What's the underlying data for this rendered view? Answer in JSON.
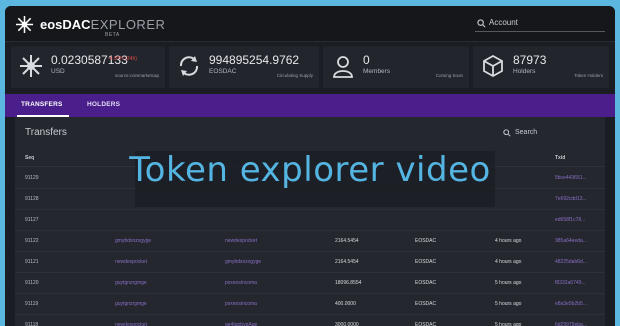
{
  "app": {
    "brand_bold": "eosDAC",
    "brand_thin": "EXPLORER",
    "beta": "BETA",
    "account_placeholder": "Account"
  },
  "stats": [
    {
      "value": "0.0230587133",
      "sub": "USD",
      "change": "-4.97% (24h)",
      "note": "source:coinmarketcap",
      "icon": "eosdac-logo-icon"
    },
    {
      "value": "994895254.9762",
      "sub": "EOSDAC",
      "note": "Circulating Supply",
      "icon": "refresh-circle-icon"
    },
    {
      "value": "0",
      "sub": "Members",
      "note": "Coming Soon",
      "icon": "user-icon"
    },
    {
      "value": "87973",
      "sub": "Holders",
      "note": "Token Holders",
      "icon": "cube-icon"
    }
  ],
  "tabs": [
    {
      "label": "TRANSFERS",
      "active": true
    },
    {
      "label": "HOLDERS",
      "active": false
    }
  ],
  "panel": {
    "title": "Transfers",
    "search_placeholder": "Search"
  },
  "table": {
    "columns": {
      "seq": "Seq",
      "txid": "Txid"
    },
    "rows": [
      {
        "seq": "91129",
        "from": "",
        "to": "",
        "qty": "",
        "symbol": "",
        "time": "",
        "txid": "5bce443651..."
      },
      {
        "seq": "91128",
        "from": "",
        "to": "",
        "qty": "",
        "symbol": "",
        "time": "",
        "txid": "7e692cdd13..."
      },
      {
        "seq": "91127",
        "from": "",
        "to": "",
        "qty": "",
        "symbol": "",
        "time": "",
        "txid": "ed658f1c78..."
      },
      {
        "seq": "91122",
        "from": "gmybdsnzxgyge",
        "to": "newdexpocket",
        "qty": "2164.5454",
        "symbol": "EOSDAC",
        "time": "4 hours ago",
        "txid": "985a64eeda..."
      },
      {
        "seq": "91121",
        "from": "newdexpocket",
        "to": "gmybdsnzxgyge",
        "qty": "2164.5454",
        "symbol": "EOSDAC",
        "time": "4 hours ago",
        "txid": "48225dab6d..."
      },
      {
        "seq": "91120",
        "from": "guytgnzrgmge",
        "to": "pxxeosincoma",
        "qty": "18096.8554",
        "symbol": "EOSDAC",
        "time": "5 hours ago",
        "txid": "f8332a6749..."
      },
      {
        "seq": "91119",
        "from": "guytgnzrgmge",
        "to": "pxxeosincoma",
        "qty": "400.0000",
        "symbol": "EOSDAC",
        "time": "5 hours ago",
        "txid": "e8a3e5b2b5..."
      },
      {
        "seq": "91118",
        "from": "newdexpocket",
        "to": "ge4tgnbygAge",
        "qty": "3000.0000",
        "symbol": "EOSDAC",
        "time": "5 hours ago",
        "txid": "6d29979eba..."
      }
    ]
  },
  "overlay_text": "Token explorer video",
  "colors": {
    "accent": "#4a1f8c",
    "link": "#8b6fc9",
    "overlay": "#55b5e2",
    "frame": "#5bb7e0"
  }
}
